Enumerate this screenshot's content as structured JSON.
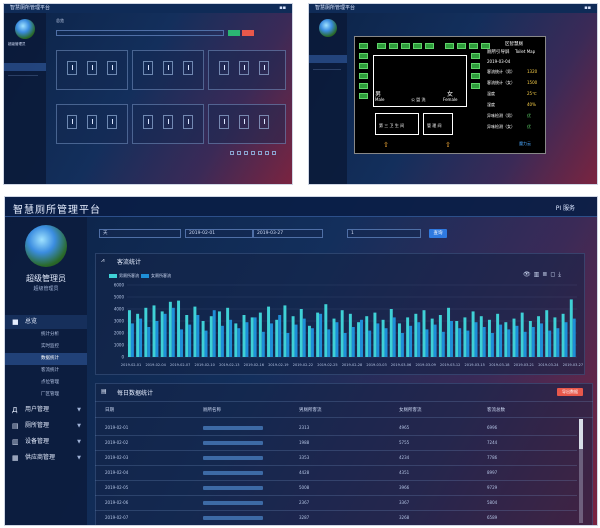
{
  "platform_title": "智慧厕所管理平台",
  "user_link": "PI 服务",
  "user": {
    "name": "超级管理员",
    "role": "超级管理员"
  },
  "sidebar": {
    "sections": [
      {
        "label": "总览",
        "items": [
          "统计分析",
          "实时监控",
          "数据统计",
          "客流统计",
          "点位管理",
          "厂区管理"
        ]
      },
      {
        "label": "用户管理"
      },
      {
        "label": "厕所管理"
      },
      {
        "label": "设备管理"
      },
      {
        "label": "供应商管理"
      }
    ],
    "active_item": "数据统计"
  },
  "filters": {
    "select_value": "天",
    "start_date": "2019-02-01",
    "end_date": "2019-03-27",
    "search_value": "1",
    "query_button": "查询"
  },
  "chart_panel_title": "客流统计",
  "table_panel_title": "每日数据统计",
  "export_button": "导出数据",
  "table": {
    "columns": [
      "日期",
      "厕所名称",
      "男厕所客流",
      "女厕所客流",
      "客流总数"
    ],
    "rows": [
      {
        "date": "2019-02-01",
        "male": "2313",
        "female": "4965",
        "total": "6996"
      },
      {
        "date": "2019-02-02",
        "male": "1988",
        "female": "5755",
        "total": "7244"
      },
      {
        "date": "2019-02-03",
        "male": "3353",
        "female": "4234",
        "total": "7786"
      },
      {
        "date": "2019-02-04",
        "male": "4428",
        "female": "4351",
        "total": "8997"
      },
      {
        "date": "2019-02-05",
        "male": "5008",
        "female": "3966",
        "total": "9729"
      },
      {
        "date": "2019-02-06",
        "male": "2367",
        "female": "3367",
        "total": "5804"
      },
      {
        "date": "2019-02-07",
        "male": "3287",
        "female": "3268",
        "total": "6589"
      }
    ]
  },
  "chart_data": {
    "type": "bar",
    "legend": [
      "男厕所客流",
      "女厕所客流"
    ],
    "legend_placement": "top-left",
    "ylim": [
      0,
      6000
    ],
    "yticks": [
      "6000",
      "5000",
      "4000",
      "3000",
      "2000",
      "1000",
      "0"
    ],
    "x_tick_labels": [
      "2019-02-01",
      "2019-02-04",
      "2019-02-07",
      "2019-02-10",
      "2019-02-13",
      "2019-02-16",
      "2019-02-19",
      "2019-02-22",
      "2019-02-25",
      "2019-02-28",
      "2019-03-03",
      "2019-03-06",
      "2019-03-09",
      "2019-03-12",
      "2019-03-15",
      "2019-03-18",
      "2019-03-21",
      "2019-03-24",
      "2019-03-27"
    ],
    "series": [
      {
        "name": "男厕所客流",
        "color": "#3fd1d6",
        "values": [
          3900,
          3600,
          4100,
          4300,
          3800,
          4600,
          4700,
          3500,
          4200,
          3000,
          3400,
          3800,
          4100,
          2800,
          3500,
          3300,
          3700,
          4200,
          3100,
          4300,
          3400,
          4000,
          2600,
          3700,
          4400,
          3200,
          3900,
          3600,
          2900,
          3400,
          3700,
          3100,
          4000,
          2800,
          3300,
          3600,
          3900,
          3200,
          3500,
          4100,
          3000,
          3300,
          3800,
          3400,
          3100,
          3600,
          2900,
          3200,
          3700,
          3000,
          3400,
          3900,
          3300,
          3600,
          4800
        ]
      },
      {
        "name": "女厕所客流",
        "color": "#1e8fd8",
        "values": [
          2800,
          3200,
          2500,
          3000,
          3600,
          4100,
          2300,
          2700,
          3500,
          2200,
          3900,
          2600,
          3100,
          2400,
          2900,
          3300,
          2100,
          2800,
          3500,
          2000,
          2700,
          3200,
          2400,
          3600,
          2300,
          2900,
          2000,
          2500,
          3100,
          2200,
          2800,
          2400,
          3300,
          2000,
          2600,
          2900,
          2300,
          2700,
          2100,
          3000,
          2400,
          2200,
          2900,
          2500,
          2000,
          2700,
          2300,
          2600,
          2100,
          2500,
          2800,
          2200,
          2400,
          2900,
          3200
        ]
      }
    ]
  },
  "card_grid": {
    "titlebar": "智慧厕所管理平台",
    "breadcrumb": "总览",
    "rooms": [
      "男厕",
      "女厕",
      "第三卫生间",
      "男厕",
      "女厕",
      "第三卫生间"
    ]
  },
  "guide_map": {
    "titlebar": "智慧厕所管理平台",
    "title_cn": "厕所引导屏",
    "title_en": "Toilet Map",
    "header": "区智慧厕",
    "male_label": "男",
    "male_en": "Male",
    "female_label": "女",
    "female_en": "Female",
    "center_label": "公 盥 洗",
    "room_left": "第 三 卫 生 间",
    "room_right": "管 理 间",
    "date": "2019-03-04",
    "stats": [
      {
        "label": "客流统计（男）",
        "value": "1320",
        "color": "#ffd44a"
      },
      {
        "label": "客流统计（女）",
        "value": "1500",
        "color": "#ffd44a"
      },
      {
        "label": "温度",
        "value": "25℃",
        "color": "#ffd44a"
      },
      {
        "label": "湿度",
        "value": "40%",
        "color": "#ffd44a"
      },
      {
        "label": "异味检测（男）",
        "value": "优",
        "color": "#5fd36a"
      },
      {
        "label": "异味检测（女）",
        "value": "优",
        "color": "#5fd36a"
      }
    ],
    "brand": "魔力云"
  }
}
